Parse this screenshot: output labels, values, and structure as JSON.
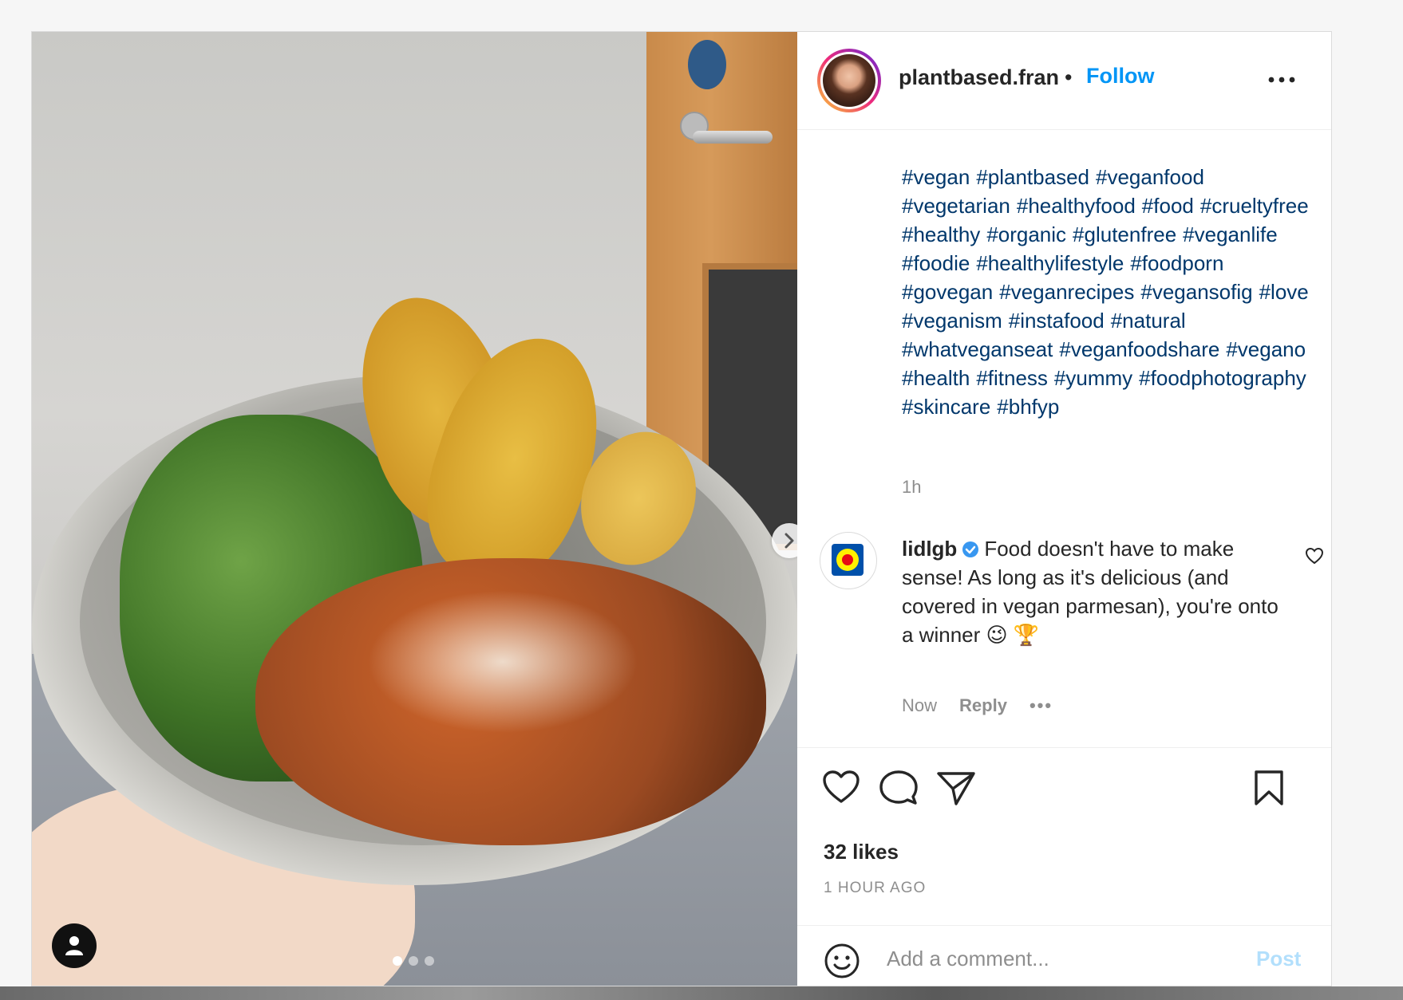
{
  "post": {
    "username": "plantbased.fran",
    "separator": "•",
    "follow_label": "Follow",
    "caption_hashtags": [
      "#vegan",
      "#plantbased",
      "#veganfood",
      "#vegetarian",
      "#healthyfood",
      "#food",
      "#crueltyfree",
      "#healthy",
      "#organic",
      "#glutenfree",
      "#veganlife",
      "#foodie",
      "#healthylifestyle",
      "#foodporn",
      "#govegan",
      "#veganrecipes",
      "#vegansofig",
      "#love",
      "#veganism",
      "#instafood",
      "#natural",
      "#whatveganseat",
      "#veganfoodshare",
      "#vegano",
      "#health",
      "#fitness",
      "#yummy",
      "#foodphotography",
      "#skincare",
      "#bhfyp"
    ],
    "caption_time": "1h",
    "likes": "32 likes",
    "time_ago": "1 HOUR AGO"
  },
  "comment": {
    "username": "lidlgb",
    "text": "Food doesn't have to make sense! As long as it's delicious (and covered in vegan parmesan), you're onto a winner 😉 🏆",
    "time": "Now",
    "reply_label": "Reply",
    "more_label": "•••"
  },
  "add_comment": {
    "placeholder": "Add a comment...",
    "post_label": "Post"
  },
  "carousel": {
    "slides": 3,
    "active_index": 0
  },
  "colors": {
    "accent": "#0095f6",
    "hashtag": "#00376b",
    "muted": "#8e8e8e",
    "text": "#262626",
    "post_disabled": "#b2dffc"
  }
}
